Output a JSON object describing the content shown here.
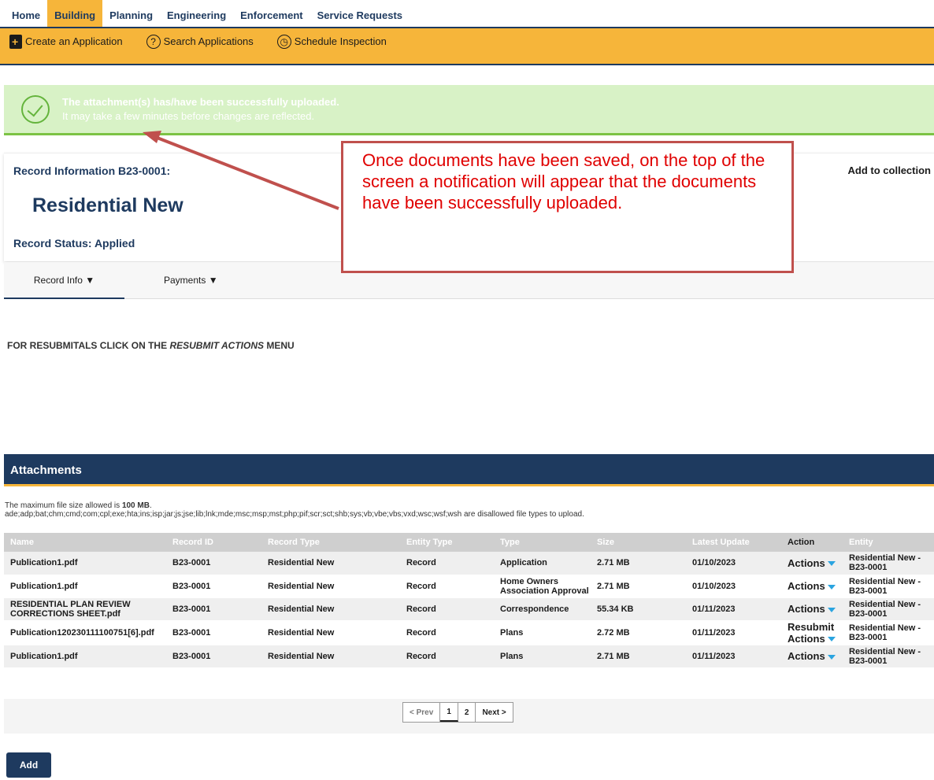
{
  "topnav": [
    "Home",
    "Building",
    "Planning",
    "Engineering",
    "Enforcement",
    "Service Requests"
  ],
  "subnav": {
    "create": "Create an Application",
    "search": "Search Applications",
    "schedule": "Schedule Inspection"
  },
  "banner": {
    "line1": "The attachment(s) has/have been successfully uploaded.",
    "line2": "It may take a few minutes before changes are reflected."
  },
  "record": {
    "label": "Record Information B23-0001:",
    "title": "Residential New",
    "status": "Record Status: Applied",
    "add_collection": "Add to collection"
  },
  "tabs": {
    "record_info": "Record Info ▼",
    "payments": "Payments ▼"
  },
  "resubmit_note": {
    "prefix": "FOR RESUBMITALS CLICK ON THE ",
    "emph": "RESUBMIT ACTIONS",
    "suffix": " MENU"
  },
  "attachments": {
    "heading": "Attachments",
    "max_size_prefix": "The maximum file size allowed is ",
    "max_size": "100 MB",
    "max_size_suffix": ".",
    "disallowed": "ade;adp;bat;chm;cmd;com;cpl;exe;hta;ins;isp;jar;js;jse;lib;lnk;mde;msc;msp;mst;php;pif;scr;sct;shb;sys;vb;vbe;vbs;vxd;wsc;wsf;wsh are disallowed file types to upload.",
    "columns": [
      "Name",
      "Record ID",
      "Record Type",
      "Entity Type",
      "Type",
      "Size",
      "Latest Update",
      "Action",
      "Entity"
    ],
    "rows": [
      {
        "name": "Publication1.pdf",
        "record_id": "B23-0001",
        "record_type": "Residential New",
        "entity_type": "Record",
        "type": "Application",
        "size": "2.71 MB",
        "updated": "01/10/2023",
        "resubmit": "",
        "action": "Actions",
        "entity": "Residential New - B23-0001"
      },
      {
        "name": "Publication1.pdf",
        "record_id": "B23-0001",
        "record_type": "Residential New",
        "entity_type": "Record",
        "type": "Home Owners Association Approval",
        "size": "2.71 MB",
        "updated": "01/10/2023",
        "resubmit": "",
        "action": "Actions",
        "entity": "Residential New - B23-0001"
      },
      {
        "name": "RESIDENTIAL PLAN REVIEW CORRECTIONS SHEET.pdf",
        "record_id": "B23-0001",
        "record_type": "Residential New",
        "entity_type": "Record",
        "type": "Correspondence",
        "size": "55.34 KB",
        "updated": "01/11/2023",
        "resubmit": "",
        "action": "Actions",
        "entity": "Residential New - B23-0001"
      },
      {
        "name": "Publication120230111100751[6].pdf",
        "record_id": "B23-0001",
        "record_type": "Residential New",
        "entity_type": "Record",
        "type": "Plans",
        "size": "2.72 MB",
        "updated": "01/11/2023",
        "resubmit": "Resubmit",
        "action": "Actions",
        "entity": "Residential New - B23-0001"
      },
      {
        "name": "Publication1.pdf",
        "record_id": "B23-0001",
        "record_type": "Residential New",
        "entity_type": "Record",
        "type": "Plans",
        "size": "2.71 MB",
        "updated": "01/11/2023",
        "resubmit": "",
        "action": "Actions",
        "entity": "Residential New - B23-0001"
      }
    ]
  },
  "pager": {
    "prev": "< Prev",
    "pages": [
      "1",
      "2"
    ],
    "next": "Next >"
  },
  "add_button": "Add",
  "callout": "Once documents have been saved, on the top of the screen a notification will appear that the documents have been successfully uploaded.",
  "colors": {
    "navy": "#1e3a5f",
    "gold": "#f6b53a",
    "success_bg": "#d8f2c6",
    "callout_border": "#c0504d",
    "callout_text": "#e00000"
  }
}
